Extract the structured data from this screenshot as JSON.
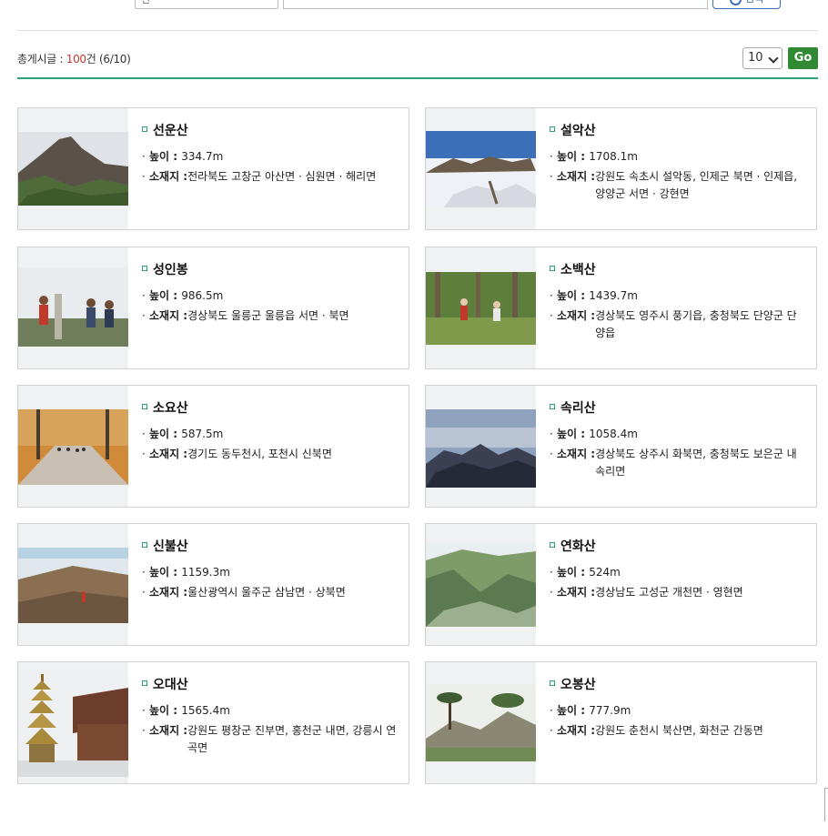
{
  "search": {
    "select_text": "전",
    "button_label": "검색"
  },
  "list": {
    "total_prefix": "총게시글 : ",
    "total_count": "100",
    "total_suffix": "건 (6/10)",
    "per_page": "10",
    "go_label": "Go"
  },
  "height_label": "높이 : ",
  "location_label": "소재지 : ",
  "mountains": [
    {
      "name": "선운산",
      "height": "334.7m",
      "location": "전라북도 고창군 아산면 · 심원면 · 해리면"
    },
    {
      "name": "설악산",
      "height": "1708.1m",
      "location": "강원도 속초시 설악동, 인제군 북면 · 인제읍, 양양군 서면 · 강현면"
    },
    {
      "name": "성인봉",
      "height": "986.5m",
      "location": "경상북도 울릉군 울릉읍 서면 · 북면"
    },
    {
      "name": "소백산",
      "height": "1439.7m",
      "location": "경상북도 영주시 풍기읍, 충청북도 단양군 단양읍"
    },
    {
      "name": "소요산",
      "height": "587.5m",
      "location": "경기도 동두천시, 포천시 신북면"
    },
    {
      "name": "속리산",
      "height": "1058.4m",
      "location": "경상북도 상주시 화북면, 충청북도 보은군 내속리면"
    },
    {
      "name": "신불산",
      "height": "1159.3m",
      "location": "울산광역시 울주군 삼남면 · 상북면"
    },
    {
      "name": "연화산",
      "height": "524m",
      "location": "경상남도 고성군 개천면 · 영현면"
    },
    {
      "name": "오대산",
      "height": "1565.4m",
      "location": "강원도 평창군 진부면, 홍천군 내면, 강릉시 연곡면"
    },
    {
      "name": "오봉산",
      "height": "777.9m",
      "location": "강원도 춘천시 북산면, 화천군 간동면"
    }
  ]
}
